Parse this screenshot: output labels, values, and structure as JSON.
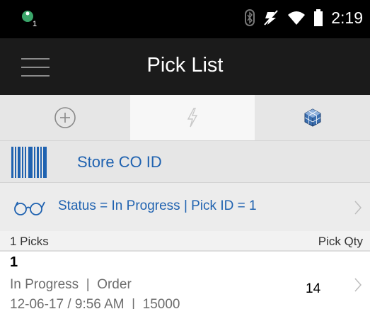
{
  "status_bar": {
    "notification_badge": "1",
    "time": "2:19",
    "icons": [
      "notification-icon",
      "bluetooth-icon",
      "mute-icon",
      "wifi-icon",
      "battery-icon"
    ]
  },
  "app_bar": {
    "title": "Pick List",
    "icons": [
      "menu-icon"
    ]
  },
  "tabs": [
    {
      "icon": "add-circle-icon",
      "selected": false
    },
    {
      "icon": "lightning-icon",
      "selected": true
    },
    {
      "icon": "cube-icon",
      "selected": false
    }
  ],
  "scan": {
    "label": "Store CO ID",
    "icon": "barcode-icon"
  },
  "filter": {
    "text": "Status = In Progress | Pick ID = 1",
    "icon": "glasses-icon"
  },
  "list_header": {
    "count_label": "1 Picks",
    "qty_label": "Pick Qty"
  },
  "rows": [
    {
      "id": "1",
      "line1": "In Progress  |  Order",
      "line2": "12-06-17 / 9:56 AM  |  15000",
      "qty": "14"
    }
  ],
  "colors": {
    "accent": "#1f62b0",
    "app_bar": "#1b1b1b",
    "status_bar": "#000000"
  }
}
